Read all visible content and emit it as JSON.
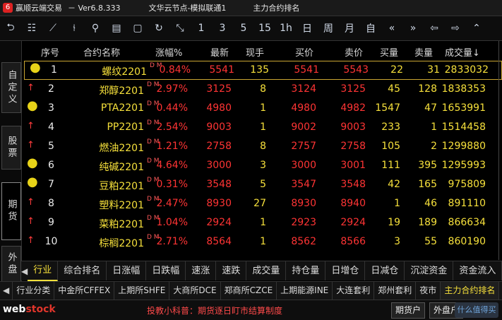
{
  "titlebar": {
    "app": "赢顺云端交易",
    "version": "－ Ver6.8.333",
    "server": "文华云节点-模拟联通1",
    "page": "主力合约排名"
  },
  "toolbar": {
    "icons": [
      "back-arrow-icon",
      "list-icon",
      "line-chart-icon",
      "candlestick-icon",
      "tick-icon",
      "board-icon",
      "save-icon",
      "refresh-icon",
      "draw-icon"
    ],
    "periods": [
      "1",
      "3",
      "5",
      "15",
      "1h",
      "日",
      "周",
      "月",
      "自"
    ]
  },
  "left_tabs": [
    {
      "label": "自定义"
    },
    {
      "label": "股票"
    },
    {
      "label": "期货"
    },
    {
      "label": "外盘"
    }
  ],
  "table": {
    "headers": {
      "seq": "序号",
      "name": "合约名称",
      "pct": "涨幅%",
      "last": "最新",
      "hand": "现手",
      "bid": "买价",
      "ask": "卖价",
      "bq": "买量",
      "aq": "卖量",
      "vol": "成交量↓"
    },
    "rows": [
      {
        "marker": "dot",
        "seq": "1",
        "name": "螺纹2201",
        "dm": "D M",
        "pct": "0.84%",
        "last": "5541",
        "hand": "135",
        "bid": "5541",
        "ask": "5543",
        "bq": "22",
        "aq": "31",
        "vol": "2833032"
      },
      {
        "marker": "arrow",
        "seq": "2",
        "name": "郑醇2201",
        "dm": "D M",
        "pct": "2.97%",
        "last": "3125",
        "hand": "8",
        "bid": "3124",
        "ask": "3125",
        "bq": "45",
        "aq": "128",
        "vol": "1838353"
      },
      {
        "marker": "dot",
        "seq": "3",
        "name": "PTA2201",
        "dm": "D M",
        "pct": "0.44%",
        "last": "4980",
        "hand": "1",
        "bid": "4980",
        "ask": "4982",
        "bq": "1547",
        "aq": "47",
        "vol": "1653991"
      },
      {
        "marker": "arrow",
        "seq": "4",
        "name": "PP2201",
        "dm": "D M",
        "pct": "2.54%",
        "last": "9003",
        "hand": "1",
        "bid": "9002",
        "ask": "9003",
        "bq": "233",
        "aq": "1",
        "vol": "1514458"
      },
      {
        "marker": "arrow",
        "seq": "5",
        "name": "燃油2201",
        "dm": "D M",
        "pct": "1.21%",
        "last": "2758",
        "hand": "8",
        "bid": "2757",
        "ask": "2758",
        "bq": "105",
        "aq": "2",
        "vol": "1299880"
      },
      {
        "marker": "dot",
        "seq": "6",
        "name": "纯碱2201",
        "dm": "D M",
        "pct": "4.64%",
        "last": "3000",
        "hand": "3",
        "bid": "3000",
        "ask": "3001",
        "bq": "111",
        "aq": "395",
        "vol": "1295993"
      },
      {
        "marker": "dot",
        "seq": "7",
        "name": "豆粕2201",
        "dm": "D M",
        "pct": "0.31%",
        "last": "3548",
        "hand": "5",
        "bid": "3547",
        "ask": "3548",
        "bq": "42",
        "aq": "165",
        "vol": "975809"
      },
      {
        "marker": "arrow",
        "seq": "8",
        "name": "塑料2201",
        "dm": "D M",
        "pct": "2.47%",
        "last": "8930",
        "hand": "27",
        "bid": "8930",
        "ask": "8940",
        "bq": "1",
        "aq": "46",
        "vol": "891110"
      },
      {
        "marker": "arrow",
        "seq": "9",
        "name": "菜粕2201",
        "dm": "D M",
        "pct": "1.04%",
        "last": "2924",
        "hand": "1",
        "bid": "2923",
        "ask": "2924",
        "bq": "19",
        "aq": "189",
        "vol": "866634"
      },
      {
        "marker": "arrow",
        "seq": "10",
        "name": "棕榈2201",
        "dm": "D M",
        "pct": "2.71%",
        "last": "8564",
        "hand": "1",
        "bid": "8562",
        "ask": "8566",
        "bq": "3",
        "aq": "55",
        "vol": "860190"
      }
    ]
  },
  "subtabs": [
    "行业",
    "综合排名",
    "日涨幅",
    "日跌幅",
    "速涨",
    "速跌",
    "成交量",
    "持仓量",
    "日增仓",
    "日减仓",
    "沉淀资金",
    "资金流入"
  ],
  "exchange_tabs": [
    "行业分类",
    "中金所CFFEX",
    "上期所SHFE",
    "大商所DCE",
    "郑商所CZCE",
    "上期能源INE",
    "大连套利",
    "郑州套利",
    "夜市",
    "主力合约排名"
  ],
  "statusbar": {
    "brand_a": "web",
    "brand_b": "stock",
    "tip": "投教小科普：期货逐日盯市结算制度",
    "btn_futures": "期货户",
    "btn_foreign": "外盘户",
    "badge": "什么值得买"
  },
  "colors": {
    "accent": "#f6e03b",
    "up": "#ff3434",
    "selected": "#caa532"
  }
}
